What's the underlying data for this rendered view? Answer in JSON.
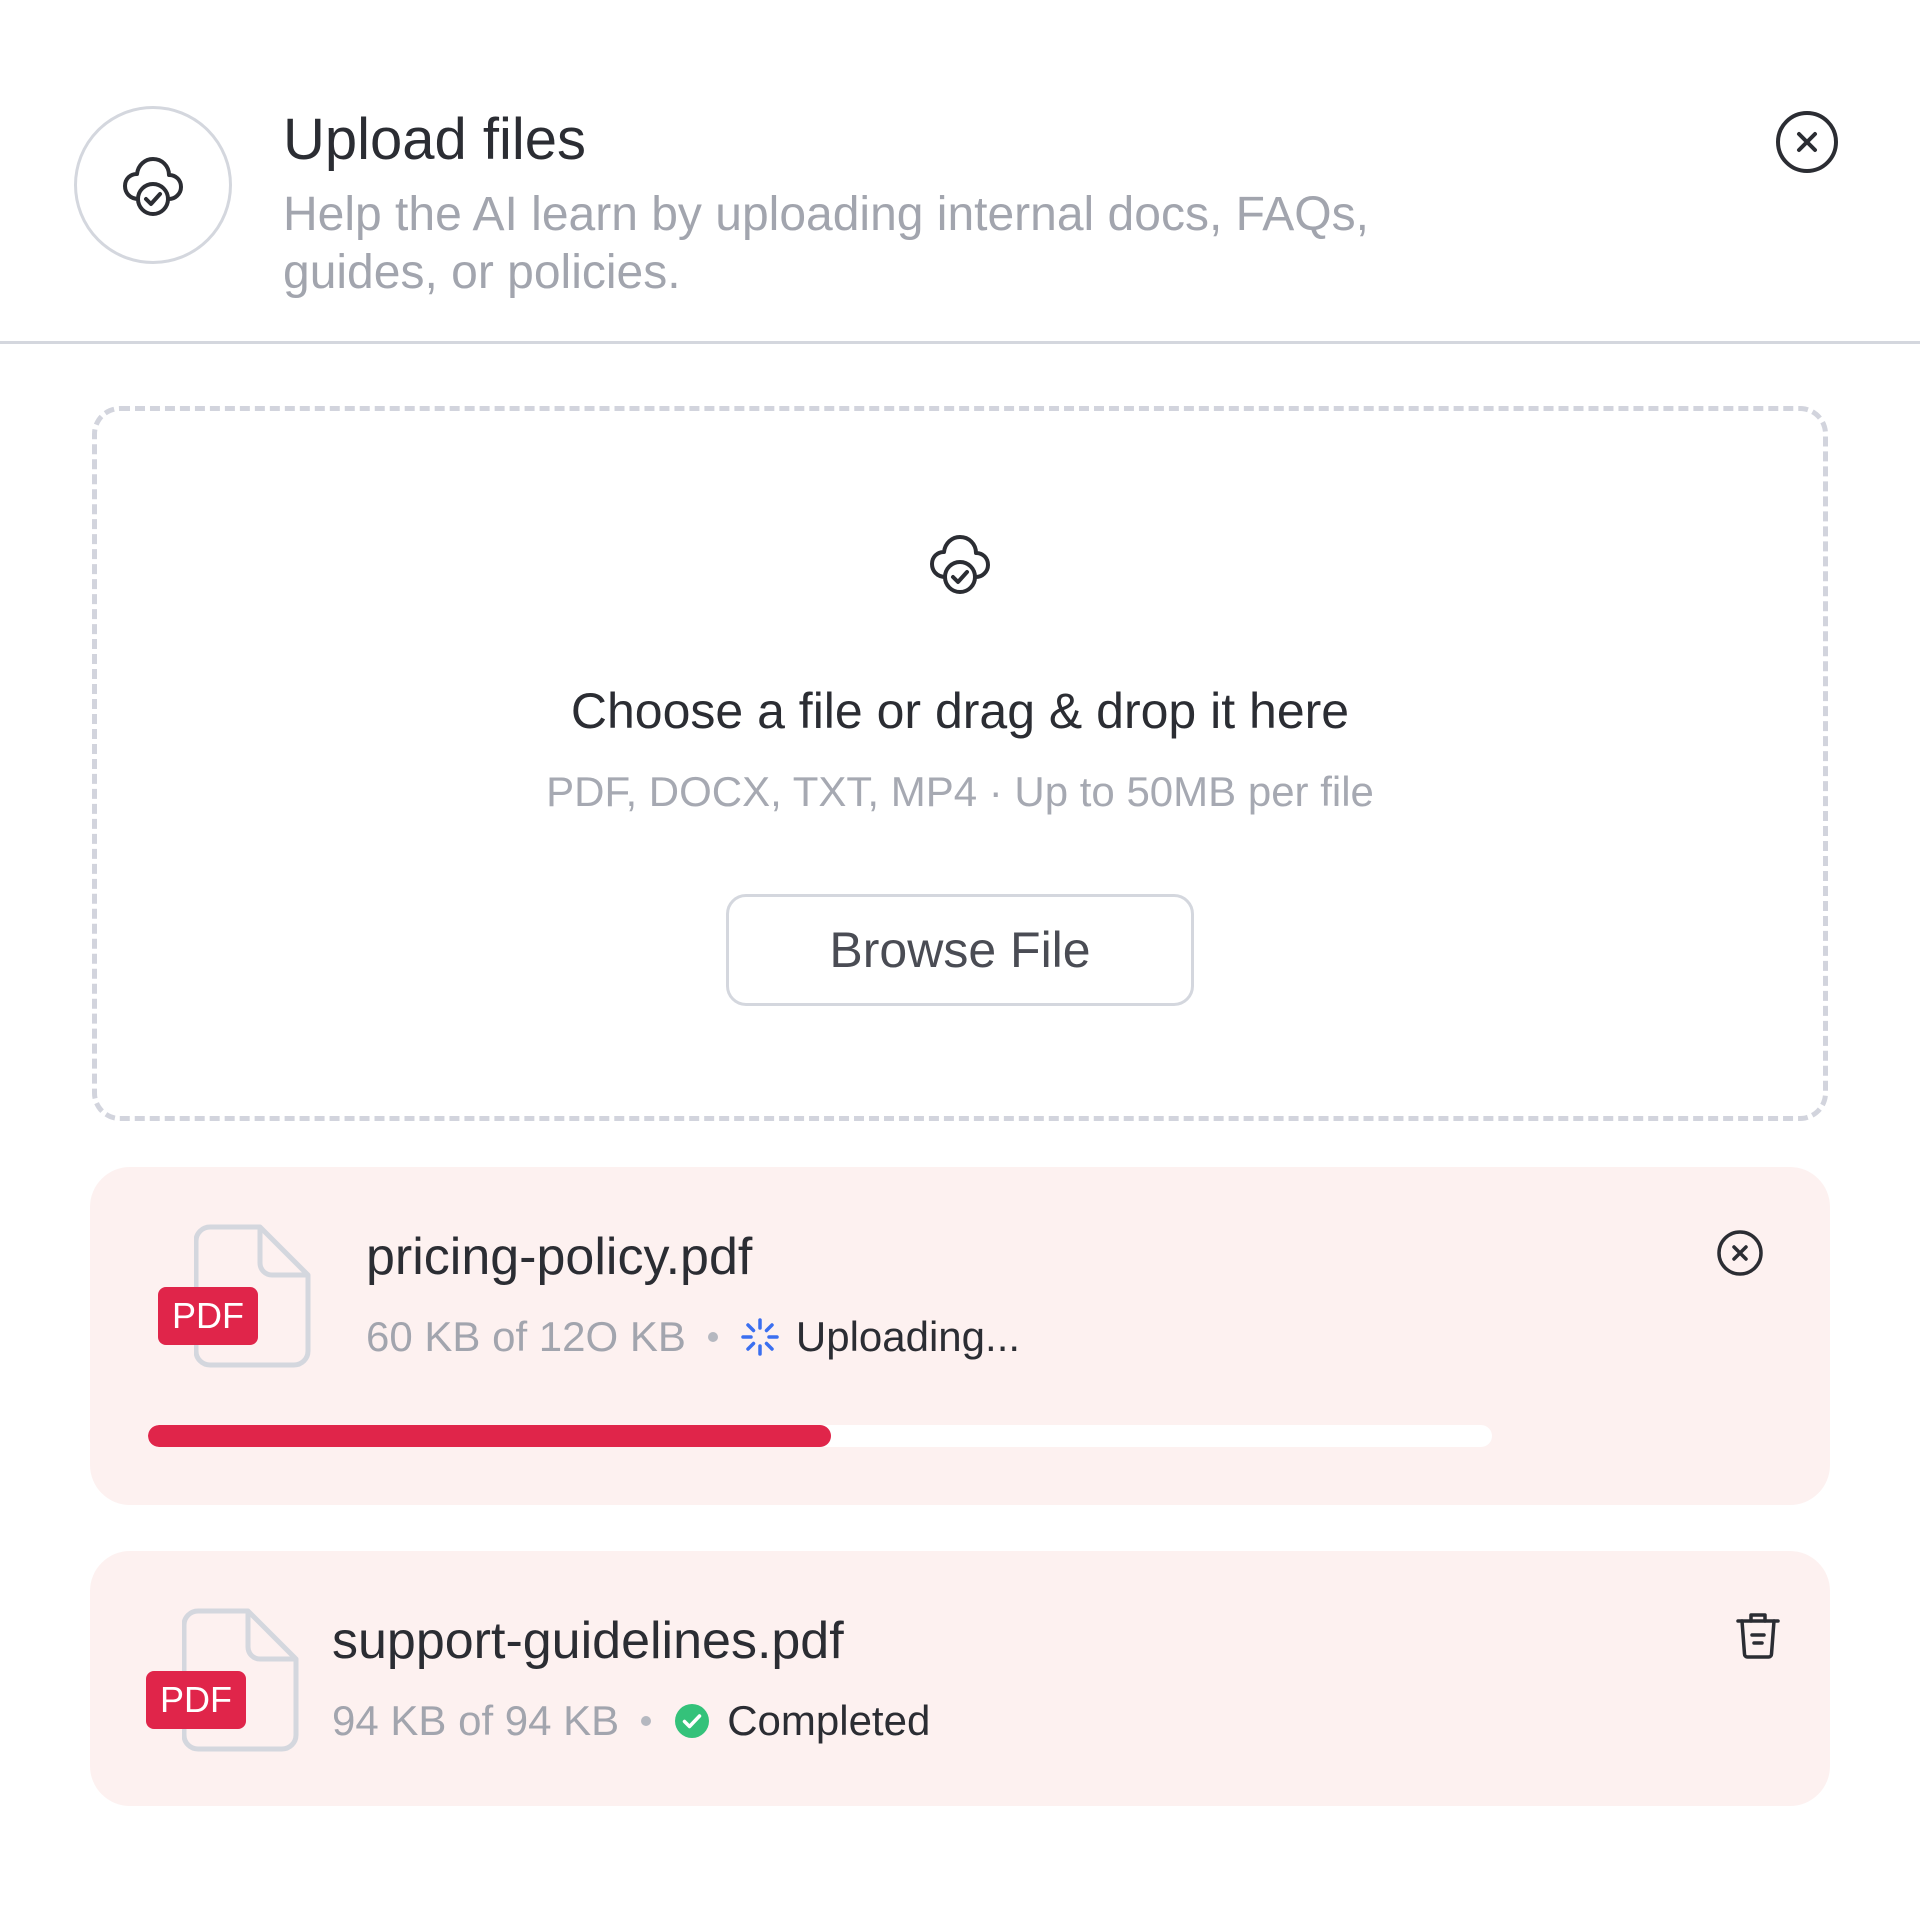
{
  "header": {
    "title": "Upload files",
    "subtitle": "Help the AI learn by uploading internal docs, FAQs, guides, or policies.",
    "icon": "cloud-check-icon",
    "close_icon": "close-circle-icon"
  },
  "dropzone": {
    "icon": "cloud-check-icon",
    "title": "Choose a file or drag & drop it here",
    "subtitle": "PDF, DOCX, TXT, MP4 · Up to 50MB per file",
    "browse_label": "Browse File"
  },
  "files": [
    {
      "name": "pricing-policy.pdf",
      "badge": "PDF",
      "size": "60 KB of 12O KB",
      "status": "Uploading...",
      "status_icon": "spinner-icon",
      "progress": 0.508,
      "action_icon": "close-circle-icon"
    },
    {
      "name": "support-guidelines.pdf",
      "badge": "PDF",
      "size": "94 KB of 94 KB",
      "status": "Completed",
      "status_icon": "check-circle-icon",
      "action_icon": "trash-icon"
    }
  ],
  "colors": {
    "accent": "#e0254a",
    "card_bg": "#fdf1f0",
    "success": "#34c27a",
    "spinner": "#3b6ff0",
    "muted_text": "#a2a5ae",
    "border": "#d4d7de"
  }
}
